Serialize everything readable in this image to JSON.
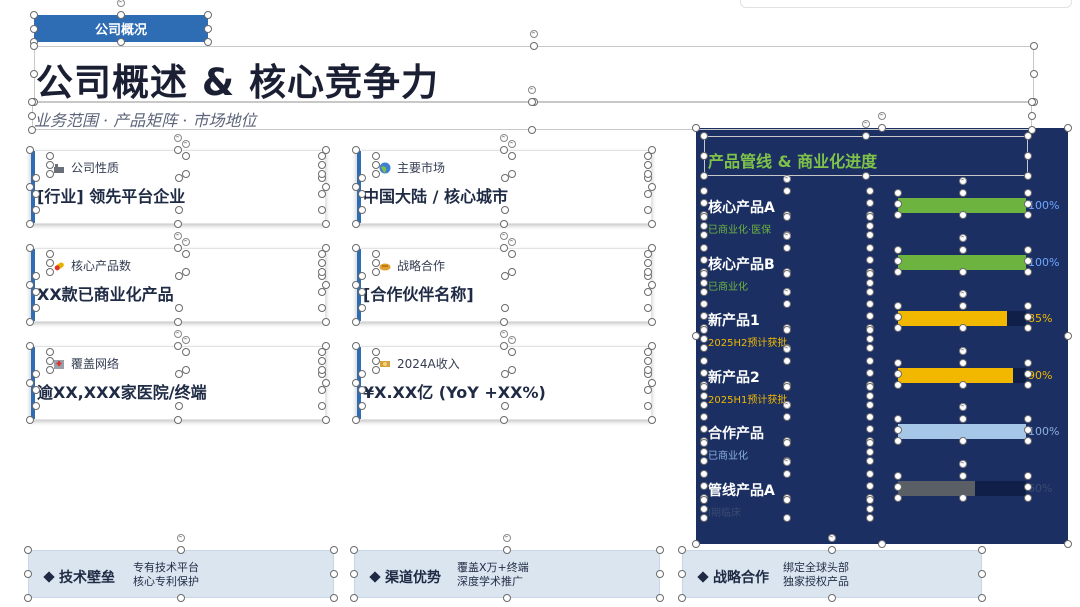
{
  "header": {
    "tag": "公司概况",
    "title": "公司概述 & 核心竞争力",
    "subtitle": "业务范围 · 产品矩阵 · 市场地位"
  },
  "cards": [
    {
      "label": "公司性质",
      "value": "[行业] 领先平台企业",
      "icon": "factory-icon"
    },
    {
      "label": "主要市场",
      "value": "中国大陆 / 核心城市",
      "icon": "globe-icon"
    },
    {
      "label": "核心产品数",
      "value": "XX款已商业化产品",
      "icon": "pill-icon"
    },
    {
      "label": "战略合作",
      "value": "[合作伙伴名称]",
      "icon": "handshake-icon"
    },
    {
      "label": "覆盖网络",
      "value": "逾XX,XXX家医院/终端",
      "icon": "hospital-icon"
    },
    {
      "label": "2024A收入",
      "value": "¥X.XX亿 (YoY +XX%)",
      "icon": "money-icon"
    }
  ],
  "pipeline": {
    "title": "产品管线 & 商业化进度",
    "products": [
      {
        "name": "核心产品A",
        "status": "已商业化·医保",
        "progress": 100,
        "pct_label": "100%",
        "color": "#6db33f",
        "status_color": "#6db33f",
        "pct_color": "#6fa8ff"
      },
      {
        "name": "核心产品B",
        "status": "已商业化",
        "progress": 100,
        "pct_label": "100%",
        "color": "#6db33f",
        "status_color": "#6db33f",
        "pct_color": "#6fa8ff"
      },
      {
        "name": "新产品1",
        "status": "2025H2预计获批",
        "progress": 85,
        "pct_label": "85%",
        "color": "#f2b800",
        "status_color": "#f2b800",
        "pct_color": "#f2b800"
      },
      {
        "name": "新产品2",
        "status": "2025H1预计获批",
        "progress": 90,
        "pct_label": "90%",
        "color": "#f2b800",
        "status_color": "#f2b800",
        "pct_color": "#f2b800"
      },
      {
        "name": "合作产品",
        "status": "已商业化",
        "progress": 100,
        "pct_label": "100%",
        "color": "#a7c7e8",
        "status_color": "#8ab0e0",
        "pct_color": "#8ab0e0"
      },
      {
        "name": "管线产品A",
        "status": "I期临床",
        "progress": 60,
        "pct_label": "60%",
        "color": "#5a5f66",
        "status_color": "#3a4a70",
        "pct_color": "#3a4a70"
      }
    ]
  },
  "strengths": [
    {
      "title": "技术壁垒",
      "lines": [
        "专有技术平台",
        "核心专利保护"
      ]
    },
    {
      "title": "渠道优势",
      "lines": [
        "覆盖X万+终端",
        "深度学术推广"
      ]
    },
    {
      "title": "战略合作",
      "lines": [
        "绑定全球头部",
        "独家授权产品"
      ]
    }
  ],
  "colors": {
    "accent": "#2e6db4",
    "panel_bg": "#1b2f62",
    "pill_bg": "#dbe5f0"
  }
}
